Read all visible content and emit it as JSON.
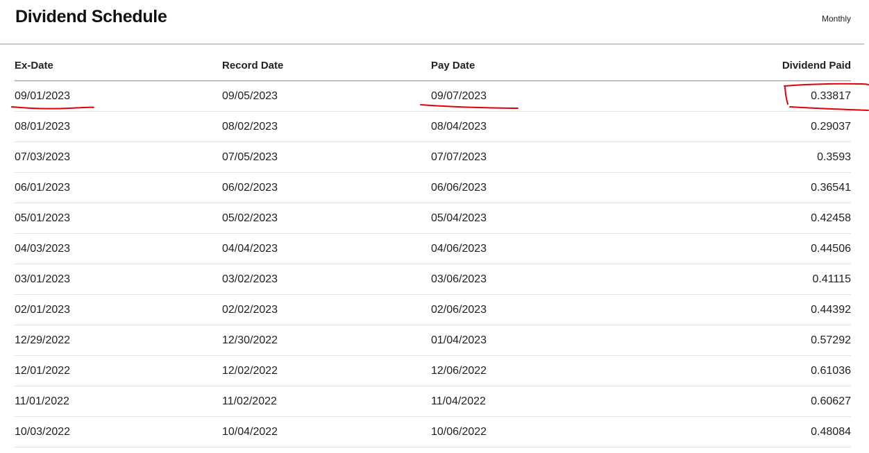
{
  "header": {
    "title": "Dividend Schedule",
    "frequency": "Monthly"
  },
  "table": {
    "columns": [
      "Ex-Date",
      "Record Date",
      "Pay Date",
      "Dividend Paid"
    ],
    "rows": [
      [
        "09/01/2023",
        "09/05/2023",
        "09/07/2023",
        "0.33817"
      ],
      [
        "08/01/2023",
        "08/02/2023",
        "08/04/2023",
        "0.29037"
      ],
      [
        "07/03/2023",
        "07/05/2023",
        "07/07/2023",
        "0.3593"
      ],
      [
        "06/01/2023",
        "06/02/2023",
        "06/06/2023",
        "0.36541"
      ],
      [
        "05/01/2023",
        "05/02/2023",
        "05/04/2023",
        "0.42458"
      ],
      [
        "04/03/2023",
        "04/04/2023",
        "04/06/2023",
        "0.44506"
      ],
      [
        "03/01/2023",
        "03/02/2023",
        "03/06/2023",
        "0.41115"
      ],
      [
        "02/01/2023",
        "02/02/2023",
        "02/06/2023",
        "0.44392"
      ],
      [
        "12/29/2022",
        "12/30/2022",
        "01/04/2023",
        "0.57292"
      ],
      [
        "12/01/2022",
        "12/02/2022",
        "12/06/2022",
        "0.61036"
      ],
      [
        "11/01/2022",
        "11/02/2022",
        "11/04/2022",
        "0.60627"
      ],
      [
        "10/03/2022",
        "10/04/2022",
        "10/06/2022",
        "0.48084"
      ]
    ]
  },
  "annotations": {
    "color": "#e00000"
  }
}
